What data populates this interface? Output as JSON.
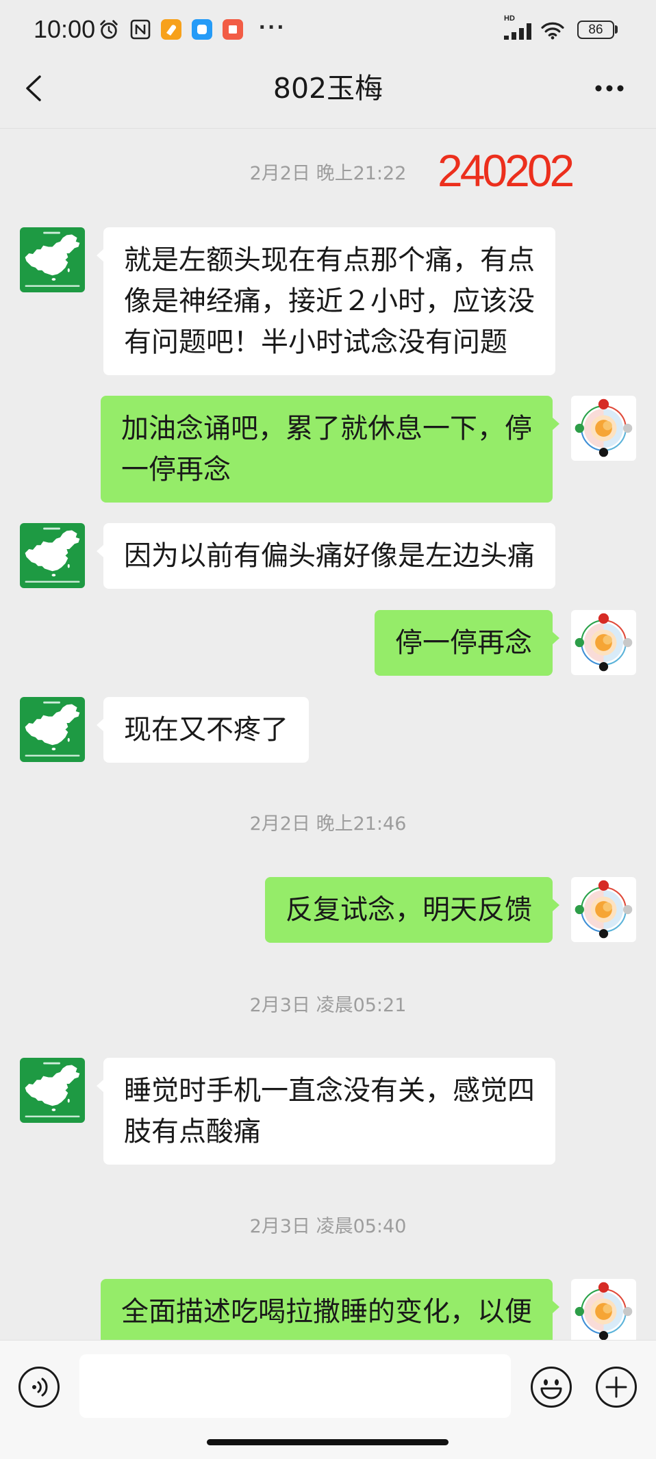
{
  "status_bar": {
    "time": "10:00",
    "notification_icons": [
      "alarm-clock-icon",
      "nfc-icon",
      "orange-app-icon",
      "blue-app-icon",
      "red-app-icon"
    ],
    "more_notifications": "···",
    "network_label": "HD",
    "signal_icon": "signal-bars-icon",
    "wifi_icon": "wifi-icon",
    "battery": "86"
  },
  "header": {
    "back_icon": "chevron-left-icon",
    "title": "802玉梅",
    "more_icon": "more-dots-icon"
  },
  "annotation": {
    "text": "240202",
    "color": "#ec2f1d"
  },
  "timestamps": [
    "2月2日 晚上21:22",
    "2月2日 晚上21:46",
    "2月3日 凌晨05:21",
    "2月3日 凌晨05:40"
  ],
  "messages": [
    {
      "avatar_icon": "china-map-avatar-icon",
      "lines": [
        "就是左额头现在有点那个痛，有点",
        "像是神经痛，接近２小时，应该没",
        "有问题吧！半小时试念没有问题"
      ]
    },
    {
      "avatar_icon": "circle-diagram-avatar-icon",
      "lines": [
        "加油念诵吧，累了就休息一下，停",
        "一停再念"
      ]
    },
    {
      "avatar_icon": "china-map-avatar-icon",
      "lines": [
        "因为以前有偏头痛好像是左边头痛"
      ]
    },
    {
      "avatar_icon": "circle-diagram-avatar-icon",
      "lines": [
        "停一停再念"
      ]
    },
    {
      "avatar_icon": "china-map-avatar-icon",
      "lines": [
        "现在又不疼了"
      ]
    },
    {
      "avatar_icon": "circle-diagram-avatar-icon",
      "lines": [
        "反复试念，明天反馈"
      ]
    },
    {
      "avatar_icon": "china-map-avatar-icon",
      "lines": [
        "睡觉时手机一直念没有关，感觉四",
        "肢有点酸痛"
      ]
    },
    {
      "avatar_icon": "circle-diagram-avatar-icon",
      "lines": [
        "全面描述吃喝拉撒睡的变化，以便"
      ]
    }
  ],
  "input_bar": {
    "voice_icon": "voice-input-icon",
    "message_value": "",
    "emoji_icon": "emoji-icon",
    "plus_icon": "plus-icon"
  },
  "colors": {
    "chat_background": "#ededed",
    "sent_bubble": "#95ec69",
    "received_bubble": "#ffffff",
    "timestamp_text": "#9d9d9d",
    "input_bar_background": "#f7f7f7"
  }
}
